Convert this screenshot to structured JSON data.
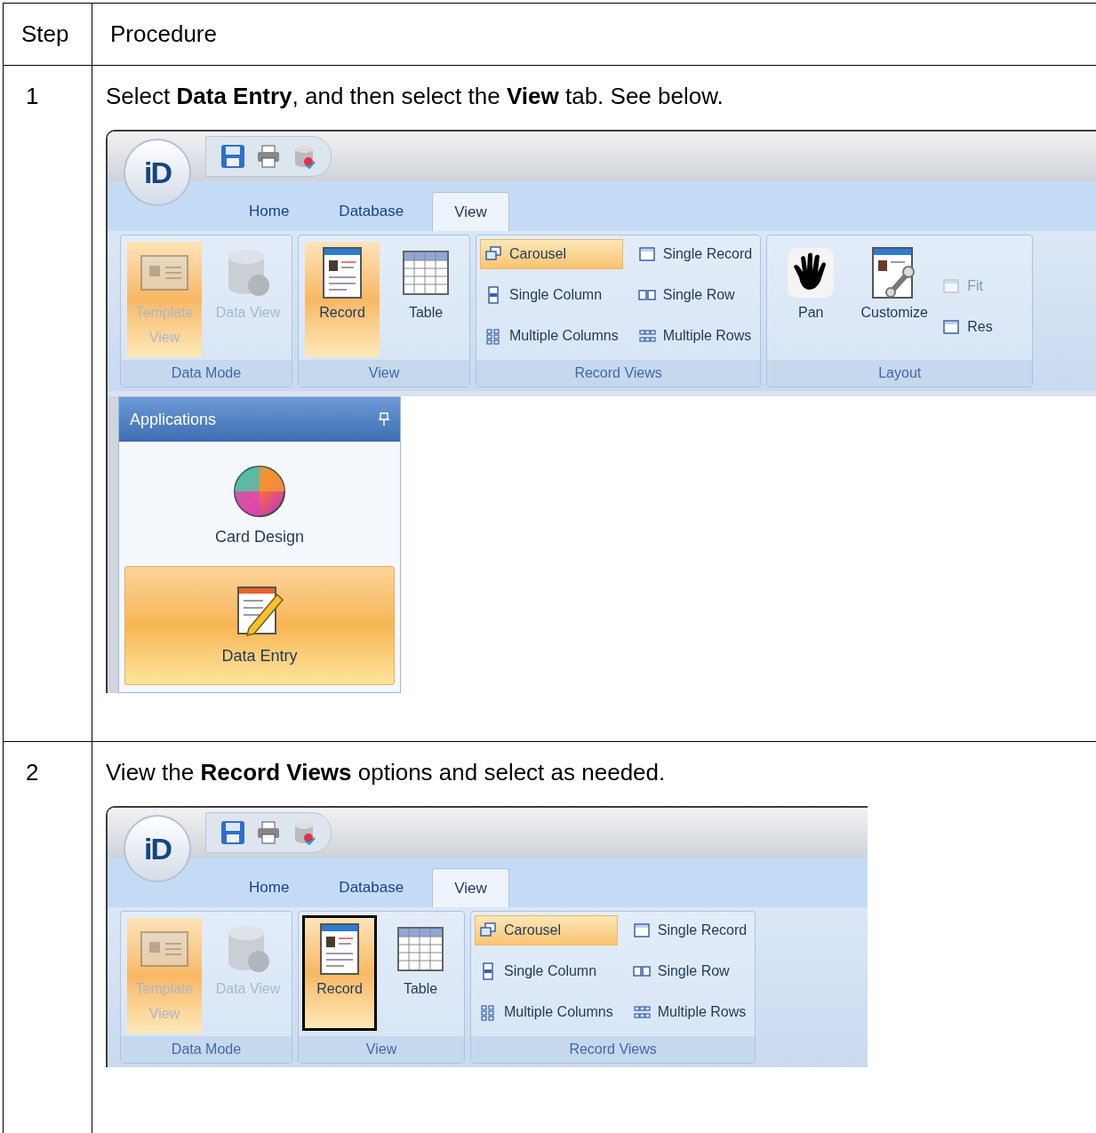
{
  "table": {
    "columns": [
      "Step",
      "Procedure"
    ],
    "rows": [
      {
        "step": "1",
        "instruction": "Select **Data Entry**, and then select the **View** tab. See below.",
        "screenshot": {
          "logo": "iD",
          "tabs": [
            {
              "label": "Home",
              "selected": false
            },
            {
              "label": "Database",
              "selected": false
            },
            {
              "label": "View",
              "selected": true
            }
          ],
          "groups": [
            {
              "label": "Data Mode",
              "items": [
                {
                  "label": "Template View",
                  "kind": "large",
                  "selected": true,
                  "disabled": true
                },
                {
                  "label": "Data View",
                  "kind": "large",
                  "selected": false,
                  "disabled": true
                }
              ]
            },
            {
              "label": "View",
              "items": [
                {
                  "label": "Record",
                  "kind": "large",
                  "selected": true,
                  "disabled": false
                },
                {
                  "label": "Table",
                  "kind": "large",
                  "selected": false,
                  "disabled": false
                }
              ]
            },
            {
              "label": "Record Views",
              "items": [
                {
                  "label": "Carousel",
                  "kind": "small",
                  "selected": true,
                  "disabled": false
                },
                {
                  "label": "Single Column",
                  "kind": "small",
                  "selected": false,
                  "disabled": false
                },
                {
                  "label": "Multiple Columns",
                  "kind": "small",
                  "selected": false,
                  "disabled": false
                },
                {
                  "label": "Single Record",
                  "kind": "small",
                  "selected": false,
                  "disabled": false
                },
                {
                  "label": "Single Row",
                  "kind": "small",
                  "selected": false,
                  "disabled": false
                },
                {
                  "label": "Multiple Rows",
                  "kind": "small",
                  "selected": false,
                  "disabled": false
                }
              ]
            },
            {
              "label": "Layout",
              "items": [
                {
                  "label": "Pan",
                  "kind": "large",
                  "selected": false,
                  "disabled": false
                },
                {
                  "label": "Customize",
                  "kind": "large",
                  "selected": false,
                  "disabled": false
                },
                {
                  "label": "Fit",
                  "kind": "small",
                  "selected": false,
                  "disabled": true
                },
                {
                  "label": "Res",
                  "kind": "small",
                  "selected": false,
                  "disabled": false
                }
              ]
            }
          ],
          "panel": {
            "title": "Applications",
            "items": [
              {
                "label": "Card Design",
                "selected": false
              },
              {
                "label": "Data Entry",
                "selected": true
              }
            ]
          }
        }
      },
      {
        "step": "2",
        "instruction": "View the **Record Views** options and select as needed.",
        "screenshot": {
          "logo": "iD",
          "tabs": [
            {
              "label": "Home",
              "selected": false
            },
            {
              "label": "Database",
              "selected": false
            },
            {
              "label": "View",
              "selected": true
            }
          ],
          "groups": [
            {
              "label": "Data Mode",
              "items": [
                {
                  "label": "Template View",
                  "kind": "large",
                  "selected": true,
                  "disabled": true,
                  "outlined": false
                },
                {
                  "label": "Data View",
                  "kind": "large",
                  "selected": false,
                  "disabled": true,
                  "outlined": false
                }
              ]
            },
            {
              "label": "View",
              "items": [
                {
                  "label": "Record",
                  "kind": "large",
                  "selected": true,
                  "disabled": false,
                  "outlined": true
                },
                {
                  "label": "Table",
                  "kind": "large",
                  "selected": false,
                  "disabled": false,
                  "outlined": false
                }
              ]
            },
            {
              "label": "Record Views",
              "items": [
                {
                  "label": "Carousel",
                  "kind": "small",
                  "selected": true,
                  "disabled": false,
                  "outlined": false
                },
                {
                  "label": "Single Column",
                  "kind": "small",
                  "selected": false,
                  "disabled": false,
                  "outlined": false
                },
                {
                  "label": "Multiple Columns",
                  "kind": "small",
                  "selected": false,
                  "disabled": false,
                  "outlined": false
                },
                {
                  "label": "Single Record",
                  "kind": "small",
                  "selected": false,
                  "disabled": false,
                  "outlined": false
                },
                {
                  "label": "Single Row",
                  "kind": "small",
                  "selected": false,
                  "disabled": false,
                  "outlined": false
                },
                {
                  "label": "Multiple Rows",
                  "kind": "small",
                  "selected": false,
                  "disabled": false,
                  "outlined": false
                }
              ]
            }
          ]
        }
      }
    ]
  }
}
